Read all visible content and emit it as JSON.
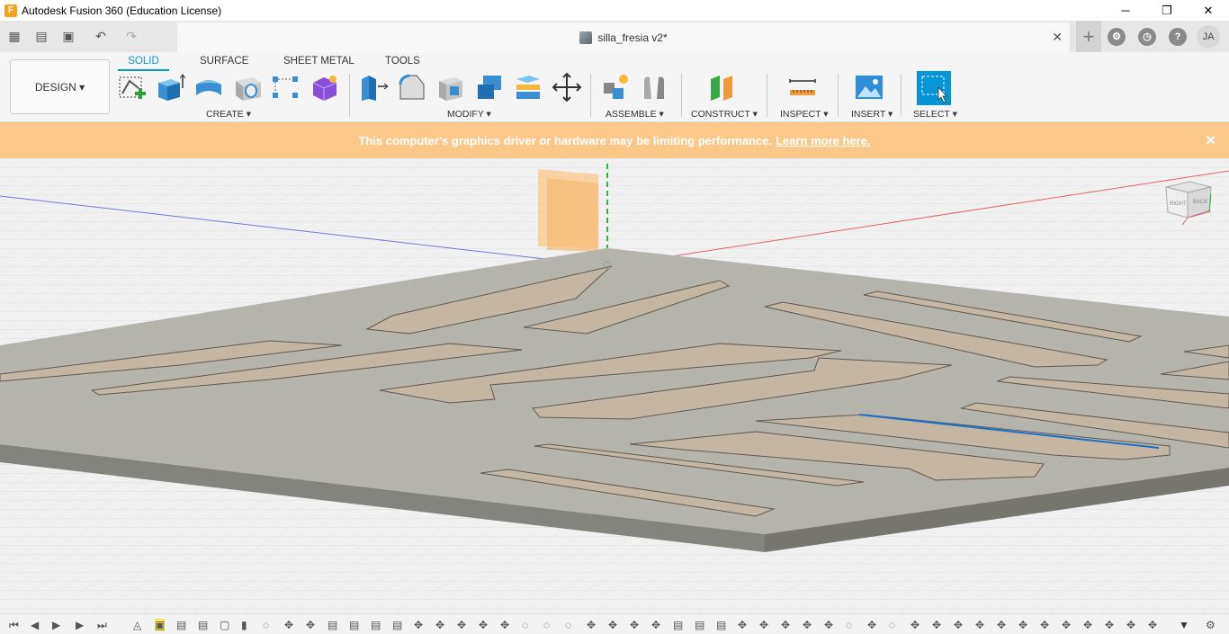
{
  "window": {
    "title": "Autodesk Fusion 360 (Education License)",
    "app_icon": "F",
    "minimize": "─",
    "restore": "❐",
    "close": "✕"
  },
  "quickaccess": {
    "grid_icon": "▦",
    "file_icon": "▤",
    "save_icon": "▣",
    "undo_icon": "↶",
    "redo_icon": "↷"
  },
  "document": {
    "name": "silla_fresia v2*",
    "close": "✕"
  },
  "header_right": {
    "new_tab": "+",
    "user_initials": "JA"
  },
  "workspace": {
    "label": "DESIGN ▾"
  },
  "tabs": [
    "SOLID",
    "SURFACE",
    "SHEET METAL",
    "TOOLS"
  ],
  "groups": {
    "create": "CREATE ▾",
    "modify": "MODIFY ▾",
    "assemble": "ASSEMBLE ▾",
    "construct": "CONSTRUCT ▾",
    "inspect": "INSPECT ▾",
    "insert": "INSERT ▾",
    "select": "SELECT ▾"
  },
  "banner": {
    "message": "This computer's graphics driver or hardware may be limiting performance.",
    "link": "Learn more here.",
    "close": "✕"
  },
  "viewcube": {
    "right": "RIGHT",
    "back": "BACK"
  },
  "colors": {
    "accent": "#0696d7",
    "banner": "#fbc88a",
    "select_tool": "#0696d7"
  }
}
